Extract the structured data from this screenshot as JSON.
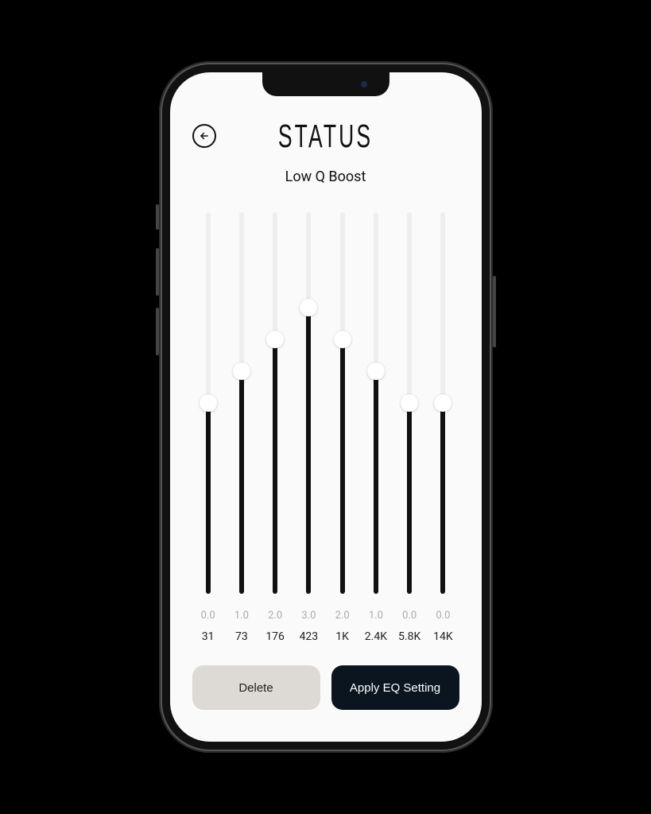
{
  "header": {
    "title": "STATUS",
    "preset_name": "Low Q Boost"
  },
  "eq": {
    "max_db": 6.0,
    "min_db": -6.0,
    "bands": [
      {
        "freq": "31",
        "value": "0.0",
        "db": 0.0
      },
      {
        "freq": "73",
        "value": "1.0",
        "db": 1.0
      },
      {
        "freq": "176",
        "value": "2.0",
        "db": 2.0
      },
      {
        "freq": "423",
        "value": "3.0",
        "db": 3.0
      },
      {
        "freq": "1K",
        "value": "2.0",
        "db": 2.0
      },
      {
        "freq": "2.4K",
        "value": "1.0",
        "db": 1.0
      },
      {
        "freq": "5.8K",
        "value": "0.0",
        "db": 0.0
      },
      {
        "freq": "14K",
        "value": "0.0",
        "db": 0.0
      }
    ]
  },
  "actions": {
    "delete_label": "Delete",
    "apply_label": "Apply EQ Setting"
  }
}
